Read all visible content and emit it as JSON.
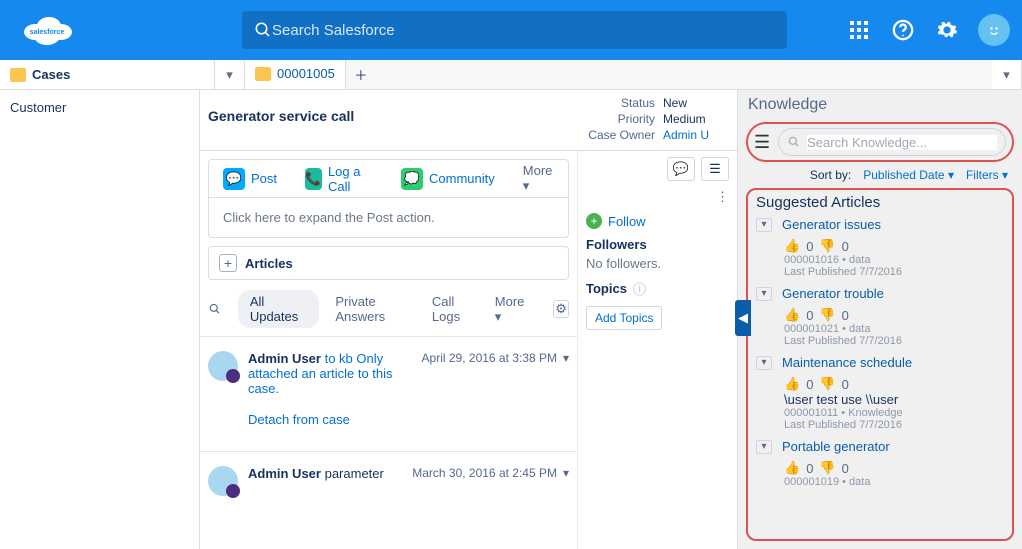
{
  "header": {
    "search_placeholder": "Search Salesforce"
  },
  "tabs": {
    "nav_label": "Cases",
    "open_tab": "00001005"
  },
  "left": {
    "label": "Customer"
  },
  "case": {
    "title": "Generator service call",
    "fields": {
      "status_label": "Status",
      "status_value": "New",
      "priority_label": "Priority",
      "priority_value": "Medium",
      "owner_label": "Case Owner",
      "owner_value": "Admin U"
    }
  },
  "actions": {
    "post": "Post",
    "log_call": "Log a Call",
    "community": "Community",
    "more": "More",
    "expand_hint": "Click here to expand the Post action."
  },
  "articles": {
    "add_label": "Articles"
  },
  "filters": {
    "all_updates": "All Updates",
    "private": "Private Answers",
    "call_logs": "Call Logs",
    "more": "More"
  },
  "feed": [
    {
      "user": "Admin User",
      "text": "to kb Only attached an article to this case.",
      "date": "April 29, 2016 at 3:38 PM",
      "detach": "Detach from case"
    },
    {
      "user": "Admin User",
      "text": "parameter",
      "date": "March 30, 2016 at 2:45 PM"
    }
  ],
  "side": {
    "follow": "Follow",
    "followers_label": "Followers",
    "no_followers": "No followers.",
    "topics_label": "Topics",
    "add_topics": "Add Topics"
  },
  "knowledge": {
    "title": "Knowledge",
    "search_placeholder": "Search Knowledge...",
    "sort_label": "Sort by:",
    "sort_value": "Published Date",
    "filters_label": "Filters",
    "suggested_title": "Suggested Articles",
    "items": [
      {
        "title": "Generator issues",
        "up": "0",
        "down": "0",
        "meta1": "000001016 • data",
        "meta2": "Last Published 7/7/2016"
      },
      {
        "title": "Generator trouble",
        "up": "0",
        "down": "0",
        "meta1": "000001021 • data",
        "meta2": "Last Published 7/7/2016"
      },
      {
        "title": "Maintenance schedule",
        "up": "0",
        "down": "0",
        "note": "\\user test use \\\\user",
        "meta1": "000001011 • Knowledge",
        "meta2": "Last Published 7/7/2016"
      },
      {
        "title": "Portable generator",
        "up": "0",
        "down": "0",
        "meta1": "000001019 • data"
      }
    ]
  }
}
